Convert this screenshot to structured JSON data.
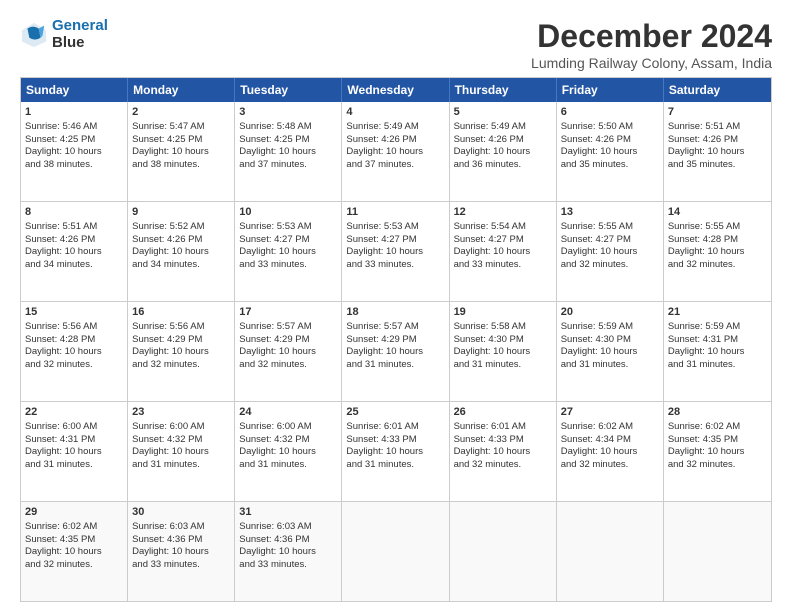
{
  "logo": {
    "line1": "General",
    "line2": "Blue"
  },
  "title": "December 2024",
  "subtitle": "Lumding Railway Colony, Assam, India",
  "headers": [
    "Sunday",
    "Monday",
    "Tuesday",
    "Wednesday",
    "Thursday",
    "Friday",
    "Saturday"
  ],
  "rows": [
    [
      {
        "day": "1",
        "text": "Sunrise: 5:46 AM\nSunset: 4:25 PM\nDaylight: 10 hours\nand 38 minutes."
      },
      {
        "day": "2",
        "text": "Sunrise: 5:47 AM\nSunset: 4:25 PM\nDaylight: 10 hours\nand 38 minutes."
      },
      {
        "day": "3",
        "text": "Sunrise: 5:48 AM\nSunset: 4:25 PM\nDaylight: 10 hours\nand 37 minutes."
      },
      {
        "day": "4",
        "text": "Sunrise: 5:49 AM\nSunset: 4:26 PM\nDaylight: 10 hours\nand 37 minutes."
      },
      {
        "day": "5",
        "text": "Sunrise: 5:49 AM\nSunset: 4:26 PM\nDaylight: 10 hours\nand 36 minutes."
      },
      {
        "day": "6",
        "text": "Sunrise: 5:50 AM\nSunset: 4:26 PM\nDaylight: 10 hours\nand 35 minutes."
      },
      {
        "day": "7",
        "text": "Sunrise: 5:51 AM\nSunset: 4:26 PM\nDaylight: 10 hours\nand 35 minutes."
      }
    ],
    [
      {
        "day": "8",
        "text": "Sunrise: 5:51 AM\nSunset: 4:26 PM\nDaylight: 10 hours\nand 34 minutes."
      },
      {
        "day": "9",
        "text": "Sunrise: 5:52 AM\nSunset: 4:26 PM\nDaylight: 10 hours\nand 34 minutes."
      },
      {
        "day": "10",
        "text": "Sunrise: 5:53 AM\nSunset: 4:27 PM\nDaylight: 10 hours\nand 33 minutes."
      },
      {
        "day": "11",
        "text": "Sunrise: 5:53 AM\nSunset: 4:27 PM\nDaylight: 10 hours\nand 33 minutes."
      },
      {
        "day": "12",
        "text": "Sunrise: 5:54 AM\nSunset: 4:27 PM\nDaylight: 10 hours\nand 33 minutes."
      },
      {
        "day": "13",
        "text": "Sunrise: 5:55 AM\nSunset: 4:27 PM\nDaylight: 10 hours\nand 32 minutes."
      },
      {
        "day": "14",
        "text": "Sunrise: 5:55 AM\nSunset: 4:28 PM\nDaylight: 10 hours\nand 32 minutes."
      }
    ],
    [
      {
        "day": "15",
        "text": "Sunrise: 5:56 AM\nSunset: 4:28 PM\nDaylight: 10 hours\nand 32 minutes."
      },
      {
        "day": "16",
        "text": "Sunrise: 5:56 AM\nSunset: 4:29 PM\nDaylight: 10 hours\nand 32 minutes."
      },
      {
        "day": "17",
        "text": "Sunrise: 5:57 AM\nSunset: 4:29 PM\nDaylight: 10 hours\nand 32 minutes."
      },
      {
        "day": "18",
        "text": "Sunrise: 5:57 AM\nSunset: 4:29 PM\nDaylight: 10 hours\nand 31 minutes."
      },
      {
        "day": "19",
        "text": "Sunrise: 5:58 AM\nSunset: 4:30 PM\nDaylight: 10 hours\nand 31 minutes."
      },
      {
        "day": "20",
        "text": "Sunrise: 5:59 AM\nSunset: 4:30 PM\nDaylight: 10 hours\nand 31 minutes."
      },
      {
        "day": "21",
        "text": "Sunrise: 5:59 AM\nSunset: 4:31 PM\nDaylight: 10 hours\nand 31 minutes."
      }
    ],
    [
      {
        "day": "22",
        "text": "Sunrise: 6:00 AM\nSunset: 4:31 PM\nDaylight: 10 hours\nand 31 minutes."
      },
      {
        "day": "23",
        "text": "Sunrise: 6:00 AM\nSunset: 4:32 PM\nDaylight: 10 hours\nand 31 minutes."
      },
      {
        "day": "24",
        "text": "Sunrise: 6:00 AM\nSunset: 4:32 PM\nDaylight: 10 hours\nand 31 minutes."
      },
      {
        "day": "25",
        "text": "Sunrise: 6:01 AM\nSunset: 4:33 PM\nDaylight: 10 hours\nand 31 minutes."
      },
      {
        "day": "26",
        "text": "Sunrise: 6:01 AM\nSunset: 4:33 PM\nDaylight: 10 hours\nand 32 minutes."
      },
      {
        "day": "27",
        "text": "Sunrise: 6:02 AM\nSunset: 4:34 PM\nDaylight: 10 hours\nand 32 minutes."
      },
      {
        "day": "28",
        "text": "Sunrise: 6:02 AM\nSunset: 4:35 PM\nDaylight: 10 hours\nand 32 minutes."
      }
    ],
    [
      {
        "day": "29",
        "text": "Sunrise: 6:02 AM\nSunset: 4:35 PM\nDaylight: 10 hours\nand 32 minutes."
      },
      {
        "day": "30",
        "text": "Sunrise: 6:03 AM\nSunset: 4:36 PM\nDaylight: 10 hours\nand 33 minutes."
      },
      {
        "day": "31",
        "text": "Sunrise: 6:03 AM\nSunset: 4:36 PM\nDaylight: 10 hours\nand 33 minutes."
      },
      {
        "day": "",
        "text": ""
      },
      {
        "day": "",
        "text": ""
      },
      {
        "day": "",
        "text": ""
      },
      {
        "day": "",
        "text": ""
      }
    ]
  ]
}
